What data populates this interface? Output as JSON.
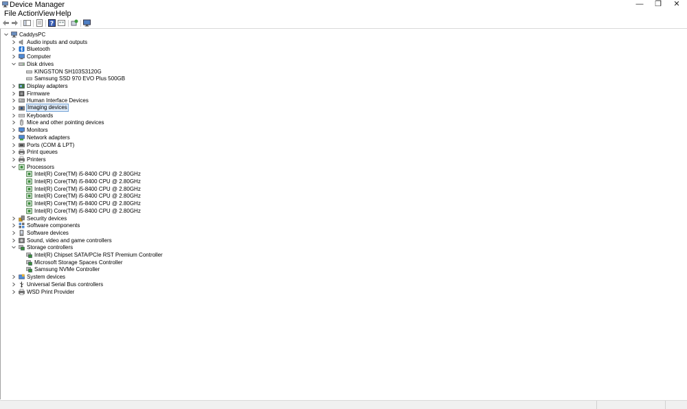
{
  "window": {
    "title": "Device Manager",
    "controls": {
      "minimize": "—",
      "restore": "❐",
      "close": "✕"
    }
  },
  "menu": [
    "File",
    "Action",
    "View",
    "Help"
  ],
  "toolbar": {
    "buttons": [
      "back-icon",
      "forward-icon",
      "show-hide-console-tree-icon",
      "properties-icon",
      "help-icon",
      "view-icon",
      "update-driver-icon",
      "scan-hardware-icon"
    ]
  },
  "tree": {
    "root": "CaddysPC",
    "categories": [
      {
        "label": "Audio inputs and outputs",
        "icon": "speaker-icon",
        "expanded": false
      },
      {
        "label": "Bluetooth",
        "icon": "bluetooth-icon",
        "expanded": false
      },
      {
        "label": "Computer",
        "icon": "computer-icon",
        "expanded": false
      },
      {
        "label": "Disk drives",
        "icon": "disk-drive-icon",
        "expanded": true,
        "children": [
          "KINGSTON SH103S3120G",
          "Samsung SSD 970 EVO Plus 500GB"
        ]
      },
      {
        "label": "Display adapters",
        "icon": "display-adapter-icon",
        "expanded": false
      },
      {
        "label": "Firmware",
        "icon": "firmware-icon",
        "expanded": false
      },
      {
        "label": "Human Interface Devices",
        "icon": "hid-icon",
        "expanded": false
      },
      {
        "label": "Imaging devices",
        "icon": "camera-icon",
        "expanded": false,
        "selected": true
      },
      {
        "label": "Keyboards",
        "icon": "keyboard-icon",
        "expanded": false
      },
      {
        "label": "Mice and other pointing devices",
        "icon": "mouse-icon",
        "expanded": false
      },
      {
        "label": "Monitors",
        "icon": "monitor-icon",
        "expanded": false
      },
      {
        "label": "Network adapters",
        "icon": "network-adapter-icon",
        "expanded": false
      },
      {
        "label": "Ports (COM & LPT)",
        "icon": "port-icon",
        "expanded": false
      },
      {
        "label": "Print queues",
        "icon": "print-queue-icon",
        "expanded": false
      },
      {
        "label": "Printers",
        "icon": "printer-icon",
        "expanded": false
      },
      {
        "label": "Processors",
        "icon": "processor-icon",
        "expanded": true,
        "children": [
          "Intel(R) Core(TM) i5-8400 CPU @ 2.80GHz",
          "Intel(R) Core(TM) i5-8400 CPU @ 2.80GHz",
          "Intel(R) Core(TM) i5-8400 CPU @ 2.80GHz",
          "Intel(R) Core(TM) i5-8400 CPU @ 2.80GHz",
          "Intel(R) Core(TM) i5-8400 CPU @ 2.80GHz",
          "Intel(R) Core(TM) i5-8400 CPU @ 2.80GHz"
        ]
      },
      {
        "label": "Security devices",
        "icon": "security-device-icon",
        "expanded": false
      },
      {
        "label": "Software components",
        "icon": "software-component-icon",
        "expanded": false
      },
      {
        "label": "Software devices",
        "icon": "software-device-icon",
        "expanded": false
      },
      {
        "label": "Sound, video and game controllers",
        "icon": "sound-controller-icon",
        "expanded": false
      },
      {
        "label": "Storage controllers",
        "icon": "storage-controller-icon",
        "expanded": true,
        "children": [
          "Intel(R) Chipset SATA/PCIe RST Premium Controller",
          "Microsoft Storage Spaces Controller",
          "Samsung NVMe Controller"
        ]
      },
      {
        "label": "System devices",
        "icon": "system-device-icon",
        "expanded": false
      },
      {
        "label": "Universal Serial Bus controllers",
        "icon": "usb-icon",
        "expanded": false
      },
      {
        "label": "WSD Print Provider",
        "icon": "wsd-printer-icon",
        "expanded": false
      }
    ]
  },
  "colors": {
    "selection_bg": "#dbe8f6",
    "selection_border": "#7aa7d8",
    "tree_border": "#a0a0a0"
  }
}
